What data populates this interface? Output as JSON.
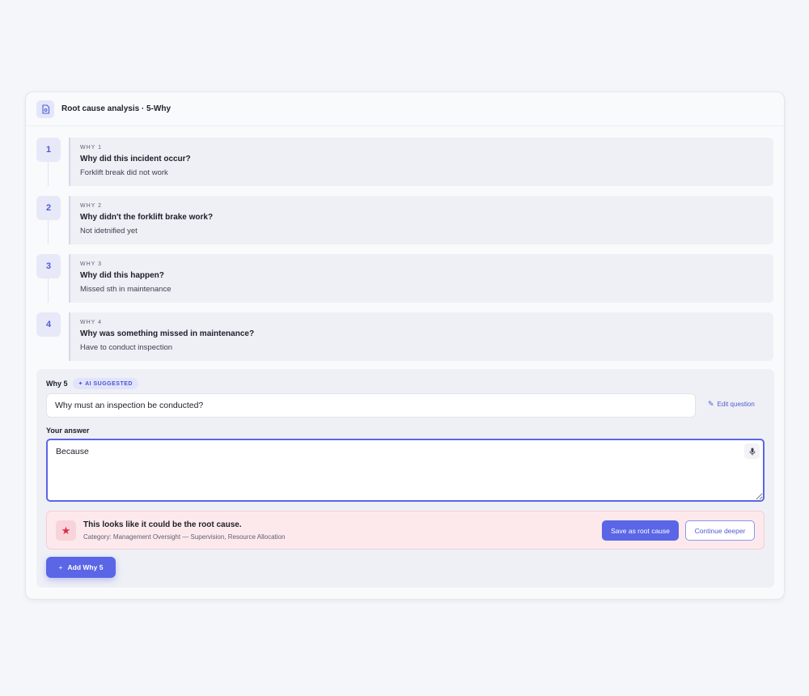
{
  "header": {
    "title": "Root cause analysis · 5-Why",
    "icon": "document-icon"
  },
  "steps": [
    {
      "number": "1",
      "label": "WHY 1",
      "question": "Why did this incident occur?",
      "answer": "Forklift break did not work"
    },
    {
      "number": "2",
      "label": "WHY 2",
      "question": "Why didn't the forklift brake work?",
      "answer": "Not idetnified yet"
    },
    {
      "number": "3",
      "label": "WHY 3",
      "question": "Why did this happen?",
      "answer": "Missed sth in maintenance"
    },
    {
      "number": "4",
      "label": "WHY 4",
      "question": "Why was something missed in maintenance?",
      "answer": "Have to conduct inspection"
    }
  ],
  "why5": {
    "label": "Why 5",
    "badge": "✦ AI SUGGESTED",
    "question": "Why must an inspection be conducted?",
    "edit_label": "Edit question",
    "answer_label": "Your answer",
    "answer_value": "Because"
  },
  "root_cause": {
    "title": "This looks like it could be the root cause.",
    "category": "Category: Management Oversight — Supervision, Resource Allocation",
    "save_label": "Save as root cause",
    "deeper_label": "Continue deeper"
  },
  "add_button": {
    "label": "Add Why 5"
  },
  "colors": {
    "accent": "#5a66e6",
    "danger": "#d62f46",
    "banner_bg": "#fde9ec"
  }
}
